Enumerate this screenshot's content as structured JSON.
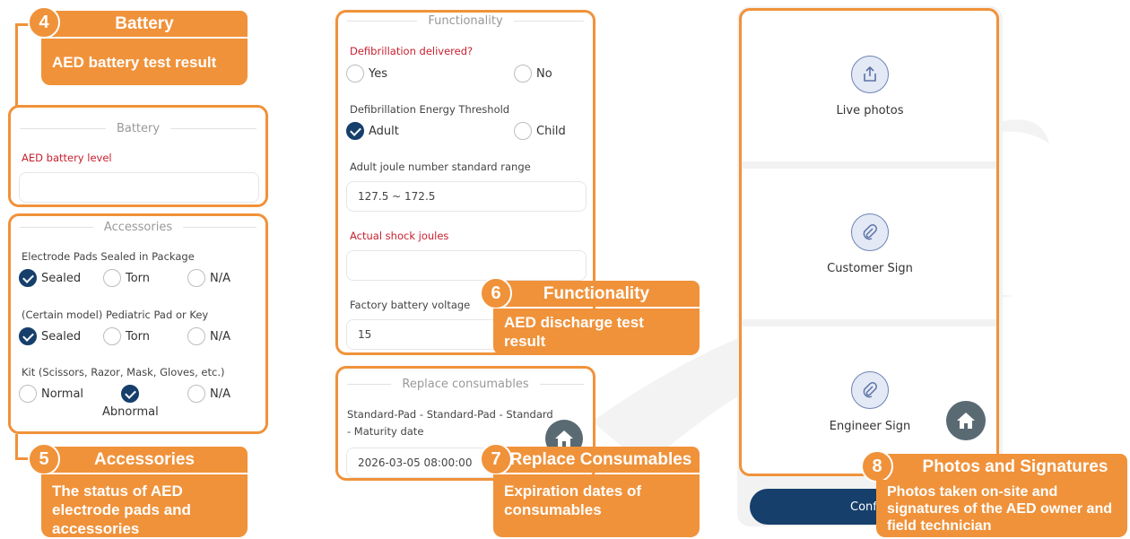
{
  "callouts": {
    "battery": {
      "number": "4",
      "title": "Battery",
      "desc": "AED battery test result"
    },
    "accessories": {
      "number": "5",
      "title": "Accessories",
      "desc": "The status of AED electrode pads and accessories"
    },
    "functionality": {
      "number": "6",
      "title": "Functionality",
      "desc": "AED discharge test result"
    },
    "consumables": {
      "number": "7",
      "title": "Replace Consumables",
      "desc": "Expiration dates of consumables"
    },
    "photos": {
      "number": "8",
      "title": "Photos and Signatures",
      "desc": "Photos taken on-site and signatures of the AED owner and field technician"
    }
  },
  "battery_section": {
    "legend": "Battery",
    "level_label": "AED battery level",
    "level_value": ""
  },
  "accessories_section": {
    "legend": "Accessories",
    "q1": {
      "label": "Electrode Pads Sealed in Package",
      "opts": [
        "Sealed",
        "Torn",
        "N/A"
      ],
      "selected": "Sealed"
    },
    "q2": {
      "label": "(Certain model) Pediatric Pad or Key",
      "opts": [
        "Sealed",
        "Torn",
        "N/A"
      ],
      "selected": "Sealed"
    },
    "q3": {
      "label": "Kit (Scissors, Razor, Mask, Gloves, etc.)",
      "opts": [
        "Normal",
        "Abnormal",
        "N/A"
      ],
      "selected": "Abnormal"
    }
  },
  "functionality_section": {
    "legend": "Functionality",
    "defib_label": "Defibrillation delivered?",
    "defib_opts": [
      "Yes",
      "No"
    ],
    "threshold_label": "Defibrillation Energy Threshold",
    "threshold_opts": [
      "Adult",
      "Child"
    ],
    "threshold_selected": "Adult",
    "range_label": "Adult joule number standard range",
    "range_value": "127.5 ~ 172.5",
    "shock_label": "Actual shock joules",
    "shock_value": "",
    "voltage_label": "Factory battery voltage",
    "voltage_value": "15"
  },
  "consumables_section": {
    "legend": "Replace consumables",
    "item_label": "Standard-Pad - Standard-Pad - Standard - Maturity date",
    "item_value": "2026-03-05 08:00:00"
  },
  "photos_section": {
    "live_photos": "Live photos",
    "customer_sign": "Customer Sign",
    "engineer_sign": "Engineer Sign",
    "confirm_label": "Confi"
  },
  "icons": {
    "upload": "share-upload-icon",
    "attach": "paperclip-icon",
    "home": "home-icon"
  },
  "colors": {
    "accent": "#f0923a",
    "checked": "#163f6b",
    "required_label": "#c8202f",
    "home_button": "#596a73"
  }
}
